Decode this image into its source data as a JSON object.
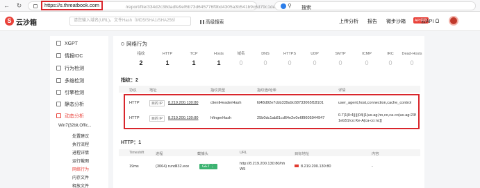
{
  "browser": {
    "url_highlight": "https://s.threatbook.com",
    "url_rest": "/report/file/334d2c38dadfe9ef6b73d645776f9bd4305a3b541b9c6d79c1de97611...",
    "search_label": "搜索",
    "search_icon": "search-icon"
  },
  "header": {
    "logo_text": "云沙箱",
    "logo_mark": "S",
    "search_placeholder": "请您输入域名(URL)，文件Hash（MD5/SHA1/SHA256）",
    "advanced_search": "高级搜索",
    "nav": [
      "上传分析",
      "报告",
      "微步沙箱"
    ],
    "badge": "API领取",
    "api": "云API"
  },
  "sidebar": {
    "items": [
      {
        "label": "XGPT",
        "icon": "x-icon"
      },
      {
        "label": "情报IOC",
        "icon": "intel-icon"
      },
      {
        "label": "行为检测",
        "icon": "behavior-icon"
      },
      {
        "label": "多维检测",
        "icon": "multi-icon"
      },
      {
        "label": "引擎检测",
        "icon": "engine-icon"
      },
      {
        "label": "静态分析",
        "icon": "static-icon"
      },
      {
        "label": "动态分析",
        "icon": "dynamic-icon"
      }
    ],
    "process": "Win7(32bit,Offic...",
    "sub_items": [
      "处置建议",
      "执行流程",
      "进程详情",
      "运行截图",
      "网络行为",
      "内存文件",
      "释放文件"
    ]
  },
  "main": {
    "section_title": "网络行为",
    "stats": [
      {
        "label": "指纹",
        "value": "2"
      },
      {
        "label": "HTTP",
        "value": "1"
      },
      {
        "label": "TCP",
        "value": "1"
      },
      {
        "label": "Hosts",
        "value": "1"
      },
      {
        "label": "域名",
        "value": "0"
      },
      {
        "label": "DNS",
        "value": "0"
      },
      {
        "label": "HTTPS",
        "value": "0"
      },
      {
        "label": "UDP",
        "value": "0"
      },
      {
        "label": "SMTP",
        "value": "0"
      },
      {
        "label": "ICMP",
        "value": "0"
      },
      {
        "label": "IRC",
        "value": "0"
      },
      {
        "label": "Dead-Hosts",
        "value": "0"
      }
    ],
    "indicators_title": "指纹：2",
    "indicator_headers": [
      "协议",
      "地址",
      "指纹类型",
      "指纹值/哈希",
      "详情"
    ],
    "indicators": [
      {
        "protocol": "HTTP",
        "tag": "目的 IP",
        "address": "8.219.200.130:80",
        "type": "clientHeaderHash",
        "hash": "fd48d92e7cbb339a9c68733065f18101",
        "detail": "user_agent,host,connection,cache_control"
      },
      {
        "protocol": "HTTP",
        "tag": "目的 IP",
        "address": "8.219.200.130:80",
        "type": "hfingerHash",
        "hash": "25b0dc1ab81cd64e2e0e6f9605944947",
        "detail_1": "0.7|1|0:4|||||04||1|us-ag,ho,co,ca-co|us-ag:23f",
        "detail_2": "1eb51/co:Ke-A|ca-co:nc]]"
      }
    ],
    "http_title": "HTTP：1",
    "http_headers": [
      "Timeshift",
      "进程",
      "截捕头",
      "URL",
      "目标地址",
      "内容"
    ],
    "http_row": {
      "timeshift": "19ms",
      "process": "(3064) rundll32.exe",
      "method": "GET",
      "url_1": "http://8.219.200.130:80/hh",
      "url_2": "W5",
      "target": "8.219.200.130:80",
      "content": "-"
    }
  }
}
